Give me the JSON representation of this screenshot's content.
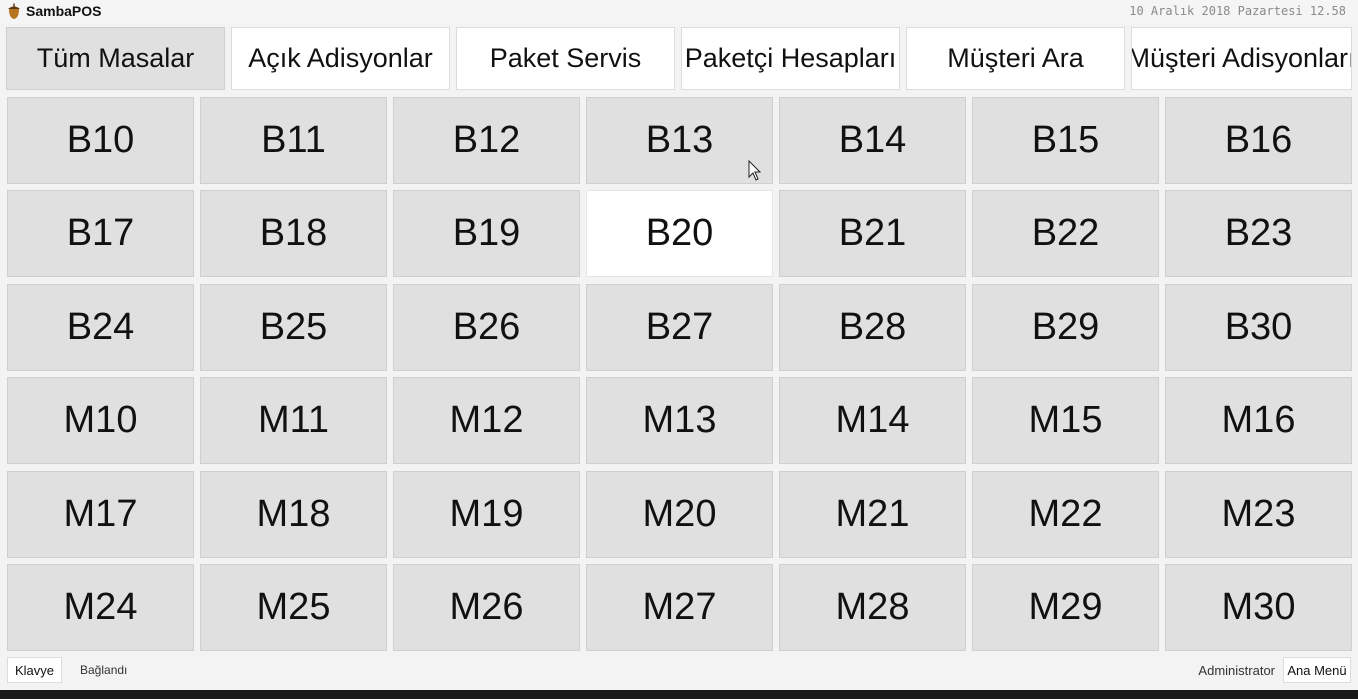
{
  "app": {
    "title": "SambaPOS",
    "datetime": "10 Aralık 2018 Pazartesi 12.58"
  },
  "tabs": [
    {
      "label": "Tüm Masalar",
      "active": true
    },
    {
      "label": "Açık Adisyonlar",
      "active": false
    },
    {
      "label": "Paket Servis",
      "active": false
    },
    {
      "label": "Paketçi Hesapları",
      "active": false
    },
    {
      "label": "Müşteri Ara",
      "active": false
    },
    {
      "label": "Müşteri Adisyonları",
      "active": false
    }
  ],
  "tables": [
    {
      "name": "B10",
      "free": false
    },
    {
      "name": "B11",
      "free": false
    },
    {
      "name": "B12",
      "free": false
    },
    {
      "name": "B13",
      "free": false
    },
    {
      "name": "B14",
      "free": false
    },
    {
      "name": "B15",
      "free": false
    },
    {
      "name": "B16",
      "free": false
    },
    {
      "name": "B17",
      "free": false
    },
    {
      "name": "B18",
      "free": false
    },
    {
      "name": "B19",
      "free": false
    },
    {
      "name": "B20",
      "free": true
    },
    {
      "name": "B21",
      "free": false
    },
    {
      "name": "B22",
      "free": false
    },
    {
      "name": "B23",
      "free": false
    },
    {
      "name": "B24",
      "free": false
    },
    {
      "name": "B25",
      "free": false
    },
    {
      "name": "B26",
      "free": false
    },
    {
      "name": "B27",
      "free": false
    },
    {
      "name": "B28",
      "free": false
    },
    {
      "name": "B29",
      "free": false
    },
    {
      "name": "B30",
      "free": false
    },
    {
      "name": "M10",
      "free": false
    },
    {
      "name": "M11",
      "free": false
    },
    {
      "name": "M12",
      "free": false
    },
    {
      "name": "M13",
      "free": false
    },
    {
      "name": "M14",
      "free": false
    },
    {
      "name": "M15",
      "free": false
    },
    {
      "name": "M16",
      "free": false
    },
    {
      "name": "M17",
      "free": false
    },
    {
      "name": "M18",
      "free": false
    },
    {
      "name": "M19",
      "free": false
    },
    {
      "name": "M20",
      "free": false
    },
    {
      "name": "M21",
      "free": false
    },
    {
      "name": "M22",
      "free": false
    },
    {
      "name": "M23",
      "free": false
    },
    {
      "name": "M24",
      "free": false
    },
    {
      "name": "M25",
      "free": false
    },
    {
      "name": "M26",
      "free": false
    },
    {
      "name": "M27",
      "free": false
    },
    {
      "name": "M28",
      "free": false
    },
    {
      "name": "M29",
      "free": false
    },
    {
      "name": "M30",
      "free": false
    }
  ],
  "statusbar": {
    "keyboard_label": "Klavye",
    "connection": "Bağlandı",
    "user": "Administrator",
    "menu_label": "Ana Menü"
  },
  "icons": {
    "logo": "acorn-icon",
    "cursor": "mouse-pointer-icon"
  },
  "colors": {
    "occupied_table": "#e0e0e0",
    "free_table": "#ffffff",
    "text": "#111111"
  }
}
